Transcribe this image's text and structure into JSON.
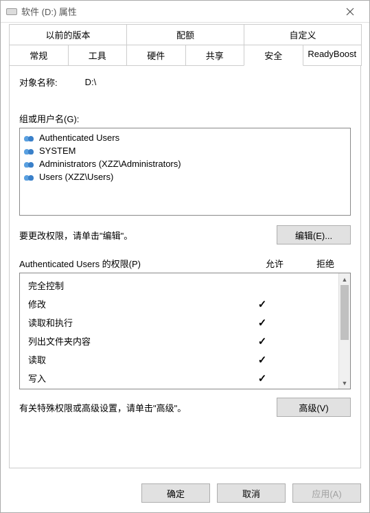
{
  "window": {
    "title": "软件 (D:) 属性"
  },
  "tabs": {
    "row1": [
      "以前的版本",
      "配额",
      "自定义"
    ],
    "row2": [
      "常规",
      "工具",
      "硬件",
      "共享",
      "安全",
      "ReadyBoost"
    ],
    "active": "安全"
  },
  "object": {
    "label": "对象名称:",
    "value": "D:\\"
  },
  "groups": {
    "label": "组或用户名(G):",
    "items": [
      "Authenticated Users",
      "SYSTEM",
      "Administrators (XZZ\\Administrators)",
      "Users (XZZ\\Users)"
    ]
  },
  "edit": {
    "text": "要更改权限，请单击\"编辑\"。",
    "button": "编辑(E)..."
  },
  "permissions": {
    "header_for": "Authenticated Users 的权限(P)",
    "col_allow": "允许",
    "col_deny": "拒绝",
    "rows": [
      {
        "name": "完全控制",
        "allow": false,
        "deny": false
      },
      {
        "name": "修改",
        "allow": true,
        "deny": false
      },
      {
        "name": "读取和执行",
        "allow": true,
        "deny": false
      },
      {
        "name": "列出文件夹内容",
        "allow": true,
        "deny": false
      },
      {
        "name": "读取",
        "allow": true,
        "deny": false
      },
      {
        "name": "写入",
        "allow": true,
        "deny": false
      }
    ]
  },
  "advanced": {
    "text": "有关特殊权限或高级设置，请单击\"高级\"。",
    "button": "高级(V)"
  },
  "footer": {
    "ok": "确定",
    "cancel": "取消",
    "apply": "应用(A)"
  }
}
